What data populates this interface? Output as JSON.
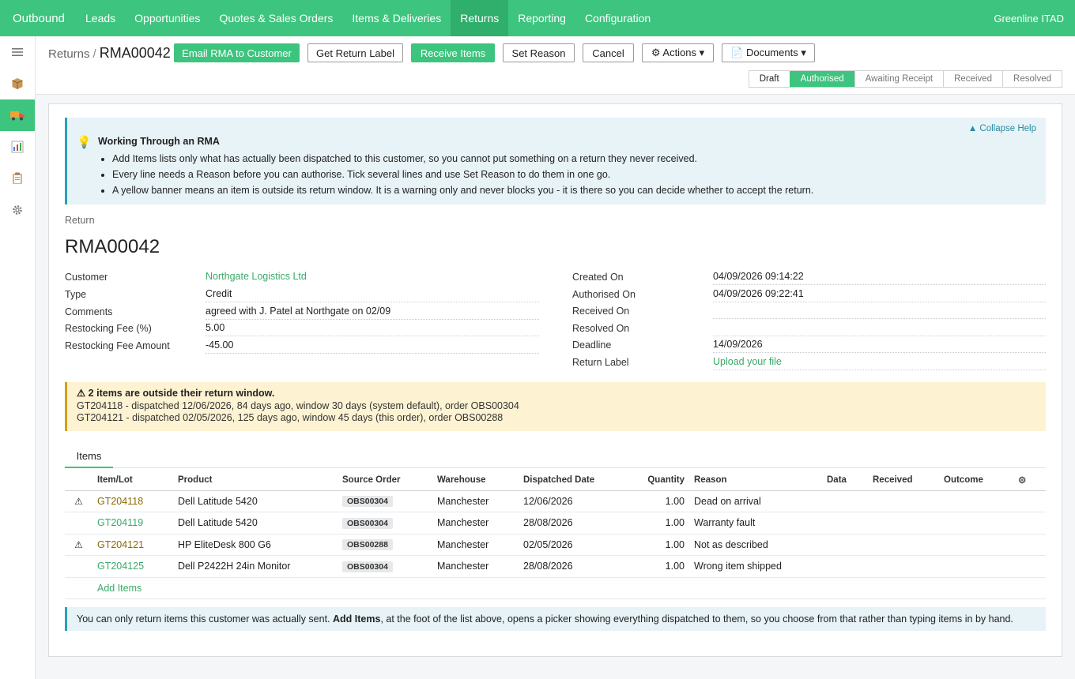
{
  "app": {
    "brand": "Outbound",
    "company": "Greenline ITAD",
    "menu": [
      {
        "label": "Leads"
      },
      {
        "label": "Opportunities"
      },
      {
        "label": "Quotes & Sales Orders"
      },
      {
        "label": "Items & Deliveries"
      },
      {
        "label": "Returns",
        "active": true
      },
      {
        "label": "Reporting"
      },
      {
        "label": "Configuration"
      }
    ]
  },
  "sidebar": {
    "items": [
      {
        "icon": "menu-icon"
      },
      {
        "icon": "package-icon"
      },
      {
        "icon": "truck-icon",
        "active": true
      },
      {
        "icon": "chart-icon"
      },
      {
        "icon": "clipboard-icon"
      },
      {
        "icon": "gear-icon"
      }
    ]
  },
  "breadcrumb": {
    "parent": "Returns",
    "separator": "/",
    "current": "RMA00042"
  },
  "toolbar": {
    "email_rma": "Email RMA to Customer",
    "get_label": "Get Return Label",
    "receive": "Receive Items",
    "set_reason": "Set Reason",
    "cancel": "Cancel",
    "actions": "⚙ Actions ▾",
    "documents": "📄 Documents ▾"
  },
  "statusbar": [
    "Draft",
    "Authorised",
    "Awaiting Receipt",
    "Received",
    "Resolved"
  ],
  "status_current": "Authorised",
  "help": {
    "collapse": "▲ Collapse Help",
    "title": "Working Through an RMA",
    "bullets": [
      "Add Items lists only what has actually been dispatched to this customer, so you cannot put something on a return they never received.",
      "Every line needs a Reason before you can authorise. Tick several lines and use Set Reason to do them in one go.",
      "A yellow banner means an item is outside its return window. It is a warning only and never blocks you - it is there so you can decide whether to accept the return."
    ]
  },
  "record": {
    "label": "Return",
    "title": "RMA00042",
    "left_fields": [
      {
        "label": "Customer",
        "value": "Northgate Logistics Ltd",
        "link": true
      },
      {
        "label": "Type",
        "value": "Credit"
      },
      {
        "label": "Comments",
        "value": "agreed with J. Patel at Northgate on 02/09"
      },
      {
        "label": "Restocking Fee (%)",
        "value": "5.00"
      },
      {
        "label": "Restocking Fee Amount",
        "value": "-45.00"
      }
    ],
    "right_fields": [
      {
        "label": "Created On",
        "value": "04/09/2026 09:14:22"
      },
      {
        "label": "Authorised On",
        "value": "04/09/2026 09:22:41"
      },
      {
        "label": "Received On",
        "value": ""
      },
      {
        "label": "Resolved On",
        "value": ""
      },
      {
        "label": "Deadline",
        "value": "14/09/2026"
      },
      {
        "label": "Return Label",
        "value": "Upload your file",
        "link": true
      }
    ]
  },
  "warning": {
    "title": "⚠ 2 items are outside their return window.",
    "lines": [
      "GT204118 - dispatched 12/06/2026, 84 days ago, window 30 days (system default), order OBS00304",
      "GT204121 - dispatched 02/05/2026, 125 days ago, window 45 days (this order), order OBS00288"
    ]
  },
  "tabs": [
    "Items"
  ],
  "items_table": {
    "columns": [
      "Item/Lot",
      "Product",
      "Source Order",
      "Warehouse",
      "Dispatched Date",
      "Quantity",
      "Reason",
      "Data",
      "Received",
      "Outcome"
    ],
    "settings_icon": "⚙",
    "rows": [
      {
        "warn": "⚠",
        "lot": "GT204118",
        "product": "Dell Latitude 5420",
        "order": "OBS00304",
        "warehouse": "Manchester",
        "date": "12/06/2026",
        "qty": "1.00",
        "reason": "Dead on arrival",
        "data": "",
        "received": "",
        "outcome": "",
        "outside_window": true
      },
      {
        "warn": "",
        "lot": "GT204119",
        "product": "Dell Latitude 5420",
        "order": "OBS00304",
        "warehouse": "Manchester",
        "date": "28/08/2026",
        "qty": "1.00",
        "reason": "Warranty fault",
        "data": "",
        "received": "",
        "outcome": "",
        "outside_window": false
      },
      {
        "warn": "⚠",
        "lot": "GT204121",
        "product": "HP EliteDesk 800 G6",
        "order": "OBS00288",
        "warehouse": "Manchester",
        "date": "02/05/2026",
        "qty": "1.00",
        "reason": "Not as described",
        "data": "",
        "received": "",
        "outcome": "",
        "outside_window": true
      },
      {
        "warn": "",
        "lot": "GT204125",
        "product": "Dell P2422H 24in Monitor",
        "order": "OBS00304",
        "warehouse": "Manchester",
        "date": "28/08/2026",
        "qty": "1.00",
        "reason": "Wrong item shipped",
        "data": "",
        "received": "",
        "outcome": "",
        "outside_window": false
      }
    ],
    "add_label": "Add Items"
  },
  "info": {
    "before": "You can only return items this customer was actually sent. ",
    "bold": "Add Items",
    "after": ", at the foot of the list above, opens a picker showing everything dispatched to them, so you choose from that rather than typing items in by hand."
  },
  "colors": {
    "brand_green": "#3dc47e",
    "active_menu": "#2fae6c",
    "help_bg": "#e7f3f7",
    "warn_bg": "#fdf3d3",
    "warn_border": "#d4a017"
  }
}
